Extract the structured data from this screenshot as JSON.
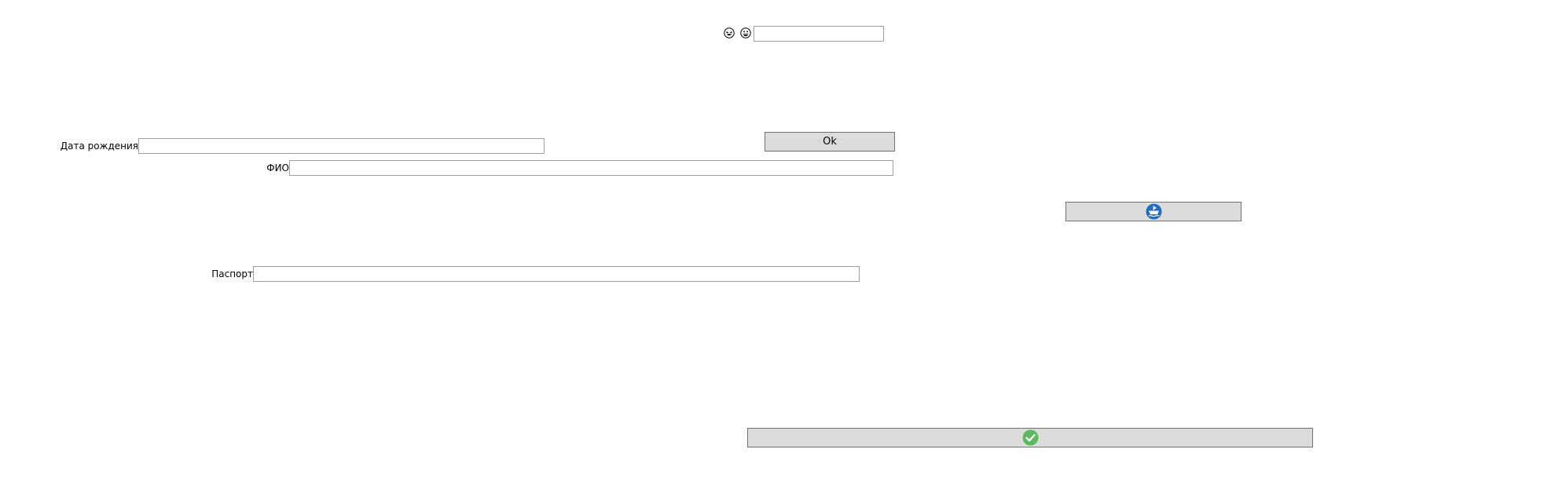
{
  "top": {
    "icons": [
      "laughing-emoji-icon",
      "grinning-emoji-icon"
    ],
    "input_value": "",
    "input_placeholder": ""
  },
  "form": {
    "birth_date": {
      "label": "Дата рождения",
      "value": "",
      "placeholder": ""
    },
    "full_name": {
      "label": "ФИО",
      "value": "",
      "placeholder": ""
    },
    "passport": {
      "label": "Паспорт",
      "value": "",
      "placeholder": ""
    }
  },
  "buttons": {
    "ok_label": "Ok",
    "ship_icon": "ship-icon",
    "confirm_icon": "checkmark-icon"
  },
  "colors": {
    "button_bg": "#dcdcdc",
    "button_border": "#707070",
    "field_border": "#a0a0a0",
    "ship_blue": "#1e6fc2",
    "check_green": "#5cb85c"
  }
}
